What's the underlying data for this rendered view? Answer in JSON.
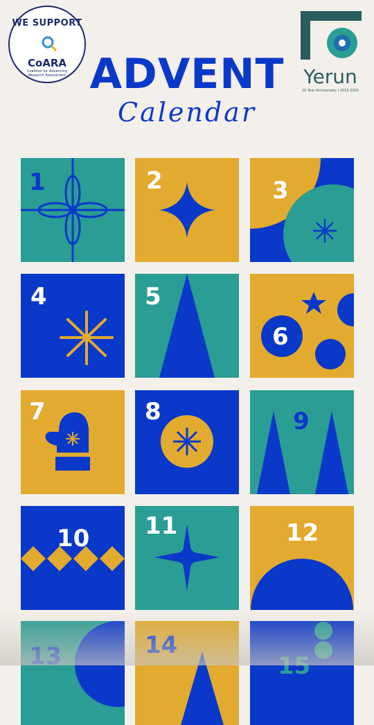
{
  "logos": {
    "coara_top": "WE SUPPORT",
    "coara_name": "CoARA",
    "coara_sub": "Coalition for Advancing Research Assessment",
    "yerun_word": "Yerun",
    "yerun_sub": "10 Year Anniversary | 2015-2025"
  },
  "title": "ADVENT",
  "subtitle": "Calendar",
  "colors": {
    "teal": "#2a9d94",
    "gold": "#e2aa2f",
    "blue": "#0a38c9",
    "bg": "#f3efea"
  },
  "days": [
    {
      "num": "1",
      "bg": "teal",
      "icon": "flower-gift-icon"
    },
    {
      "num": "2",
      "bg": "gold",
      "icon": "four-point-star-icon"
    },
    {
      "num": "3",
      "bg": "blue",
      "icon": "circles-snowflake-icon"
    },
    {
      "num": "4",
      "bg": "blue",
      "icon": "snowflake-icon"
    },
    {
      "num": "5",
      "bg": "teal",
      "icon": "tree-icon"
    },
    {
      "num": "6",
      "bg": "gold",
      "icon": "ornaments-icon"
    },
    {
      "num": "7",
      "bg": "gold",
      "icon": "mitten-icon"
    },
    {
      "num": "8",
      "bg": "blue",
      "icon": "snowflake-badge-icon"
    },
    {
      "num": "9",
      "bg": "teal",
      "icon": "two-trees-icon"
    },
    {
      "num": "10",
      "bg": "blue",
      "icon": "diamonds-icon"
    },
    {
      "num": "11",
      "bg": "teal",
      "icon": "eight-point-star-icon"
    },
    {
      "num": "12",
      "bg": "gold",
      "icon": "half-circle-icon"
    },
    {
      "num": "13",
      "bg": "teal",
      "icon": "circle-icon"
    },
    {
      "num": "14",
      "bg": "gold",
      "icon": "tree-icon"
    },
    {
      "num": "15",
      "bg": "blue",
      "icon": "circles-icon"
    }
  ]
}
